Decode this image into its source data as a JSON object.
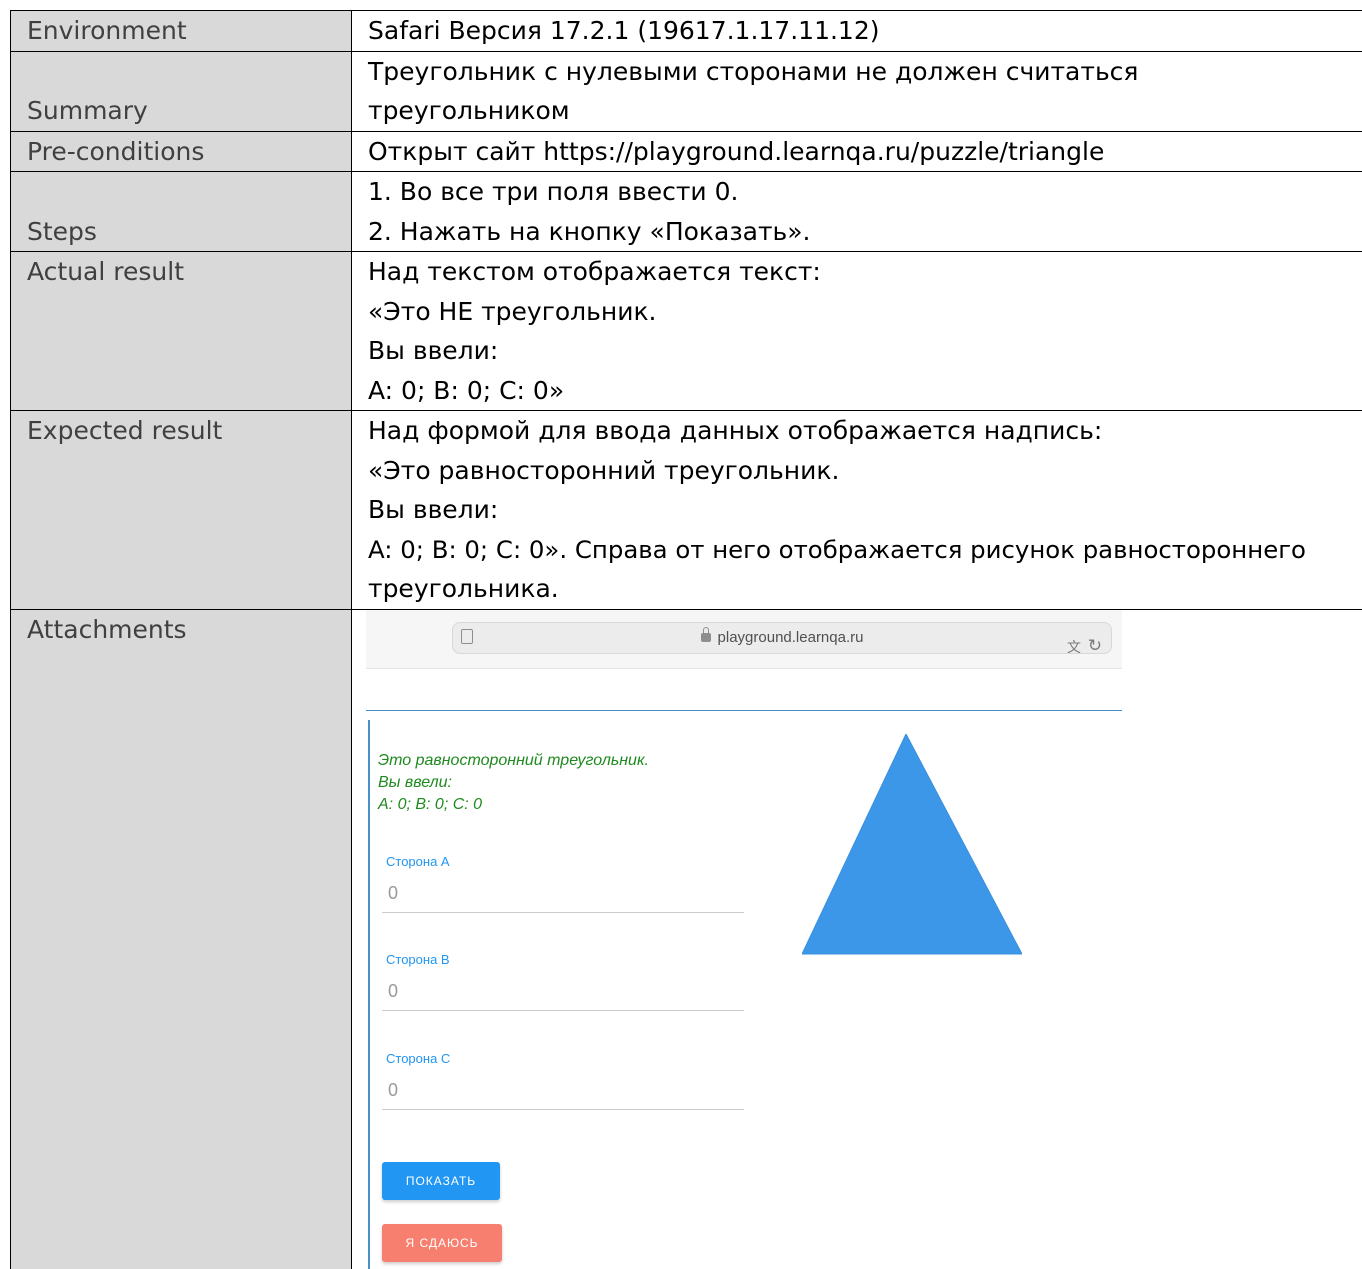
{
  "rows": {
    "environment": {
      "label": "Environment",
      "value": "Safari Версия 17.2.1 (19617.1.17.11.12)"
    },
    "summary": {
      "label": "Summary",
      "lines": [
        "Треугольник с нулевыми сторонами не должен считаться",
        "треугольником"
      ]
    },
    "preconditions": {
      "label": "Pre-conditions",
      "value": "Открыт сайт https://playground.learnqa.ru/puzzle/triangle"
    },
    "steps": {
      "label": "Steps",
      "lines": [
        "1. Во все три поля ввести 0.",
        "2. Нажать на кнопку «Показать»."
      ]
    },
    "actual": {
      "label": "Actual result",
      "lines": [
        "Над текстом отображается текст:",
        "«Это НЕ треугольник.",
        "Вы ввели:",
        "A: 0; B: 0; C: 0»"
      ]
    },
    "expected": {
      "label": "Expected result",
      "lines": [
        "Над формой для ввода данных отображается надпись:",
        "«Это равносторонний треугольник.",
        "Вы ввели:",
        "A: 0; B: 0; C: 0». Справа от него отображается рисунок равностороннего",
        "треугольника."
      ]
    },
    "attachments": {
      "label": "Attachments"
    }
  },
  "screenshot": {
    "url": "playground.learnqa.ru",
    "icons": {
      "page": "page-icon",
      "lock": "lock-icon",
      "translate": "translate-icon",
      "reload": "reload-icon"
    },
    "message": [
      "Это равносторонний треугольник.",
      "Вы ввели:",
      "A: 0; B: 0; C: 0"
    ],
    "fields": [
      {
        "label": "Сторона A",
        "value": "0"
      },
      {
        "label": "Сторона B",
        "value": "0"
      },
      {
        "label": "Сторона C",
        "value": "0"
      }
    ],
    "show_button": "ПОКАЗАТЬ",
    "giveup_button": "Я СДАЮСЬ",
    "colors": {
      "accent": "#2196f3",
      "success_text": "#1f8a1f",
      "triangle": "#3d97e8",
      "giveup": "#f77f6f"
    }
  }
}
